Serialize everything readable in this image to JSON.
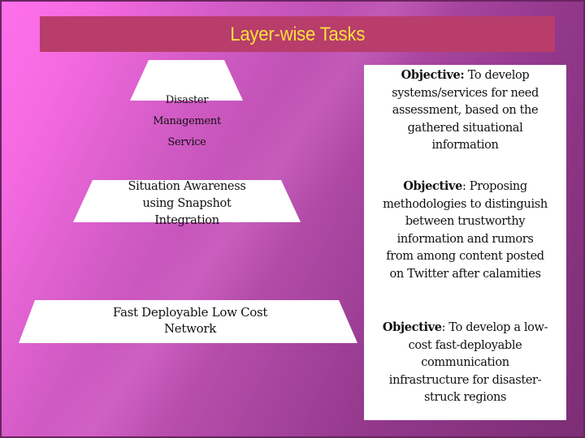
{
  "slide": {
    "title": "Layer-wise Tasks",
    "colors": {
      "title_bar": "#b83d6b",
      "title_text": "#f8e03c",
      "background_light": "#ff70ec",
      "background_dark": "#7c2e75",
      "shape_fill": "#ffffff",
      "text": "#111111"
    },
    "layers": [
      {
        "label": "Disaster\nManagement\nService",
        "lines": [
          "Disaster",
          "Management",
          "Service"
        ]
      },
      {
        "label": "Situation Awareness using Snapshot Integration",
        "lines": [
          "Situation Awareness",
          "using Snapshot",
          "Integration"
        ]
      },
      {
        "label": "Fast Deployable Low Cost Network",
        "lines": [
          "Fast Deployable Low Cost",
          "Network"
        ]
      }
    ],
    "objectives": [
      {
        "prefix": "Objective:",
        "text": " To develop systems/services for need assessment, based on the gathered situational information",
        "lines": [
          "To develop",
          "systems/services for need",
          "assessment, based on the",
          "gathered situational",
          "information"
        ]
      },
      {
        "prefix": "Objective",
        "text": ": Proposing methodologies to distinguish between trustworthy information and rumors from among content posted on Twitter after calamities",
        "lines": [
          ": Proposing",
          "methodologies to distinguish",
          "between trustworthy",
          "information and rumors",
          "from among content posted",
          "on Twitter after calamities"
        ]
      },
      {
        "prefix": "Objective",
        "text": ": To develop a low-cost fast-deployable communication infrastructure for disaster-struck regions",
        "lines": [
          ": To develop a low-",
          "cost fast-deployable",
          "communication",
          "infrastructure for disaster-",
          "struck regions"
        ]
      }
    ]
  }
}
